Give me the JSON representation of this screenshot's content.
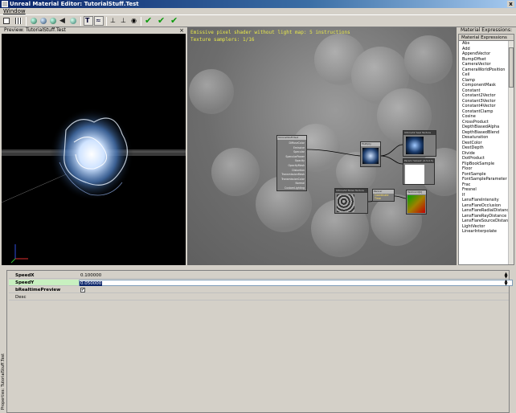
{
  "window": {
    "title": "Unreal Material Editor: TutorialStuff.Test",
    "close_label": "x"
  },
  "menu": {
    "items": [
      "Window"
    ]
  },
  "toolbar": {
    "buttons": [
      "home-icon",
      "grid-icon",
      "sphere-icon",
      "sphere-icon",
      "sphere-icon",
      "sphere-icon",
      "back-arrow-icon",
      "material-icon",
      "text-icon",
      "curve-icon",
      "node-icon",
      "node-icon",
      "eye-icon",
      "check-icon",
      "check-icon",
      "check-icon"
    ],
    "accent": "#0a9a0a"
  },
  "preview": {
    "title": "Preview: TutorialStuff.Test"
  },
  "graph": {
    "info_line1": "Emissive pixel shader without light map: 5 instructions",
    "info_line2": "Texture samplers: 1/16"
  },
  "nodes": {
    "material": {
      "title": "TutorialStuff.Test",
      "inputs": [
        "DiffuseColor",
        "Emissive",
        "Specular",
        "SpecularPower",
        "Opacity",
        "OpacityMask",
        "Distortion",
        "TransmissionMask",
        "TransmissionColor",
        "Normal",
        "CustomLighting"
      ]
    },
    "multiply": {
      "title": "Multiply"
    },
    "tex_panner": {
      "title": "Ultima32 Seal Texture"
    },
    "param": {
      "title": "Param 'Value1' (0.5,0.5)"
    },
    "tex_noise": {
      "title": "Ultima32 Noise Texture"
    },
    "panner": {
      "title": "Panner",
      "rows": [
        "Coordinate",
        "Time"
      ]
    },
    "texcoord": {
      "title": "TexCoord[0]"
    }
  },
  "expressions": {
    "title": "Material Expressions: Tuto",
    "header": "Material Expressions",
    "items": [
      "Abs",
      "Add",
      "AppendVector",
      "BumpOffset",
      "CameraVector",
      "CameraWorldPosition",
      "Ceil",
      "Clamp",
      "ComponentMask",
      "Constant",
      "Constant2Vector",
      "Constant3Vector",
      "Constant4Vector",
      "ConstantClamp",
      "Cosine",
      "CrossProduct",
      "DepthBiasedAlpha",
      "DepthBiasedBlend",
      "Desaturation",
      "DestColor",
      "DestDepth",
      "Divide",
      "DotProduct",
      "FlipBookSample",
      "Floor",
      "FontSample",
      "FontSampleParameter",
      "Frac",
      "Fresnel",
      "If",
      "LensFlareIntensity",
      "LensFlareOcclusion",
      "LensFlareRadialDistance",
      "LensFlareRayDistance",
      "LensFlareSourceDistance",
      "LightVector",
      "LinearInterpolate"
    ]
  },
  "properties": {
    "side_label": "Properties: TutorialStuff.Test",
    "rows": [
      {
        "name": "SpeedX",
        "value": "0.100000"
      },
      {
        "name": "SpeedY",
        "value": "0.050000"
      },
      {
        "name": "bRealtimePreview",
        "value": "✔"
      },
      {
        "name": "Desc",
        "value": ""
      }
    ]
  }
}
